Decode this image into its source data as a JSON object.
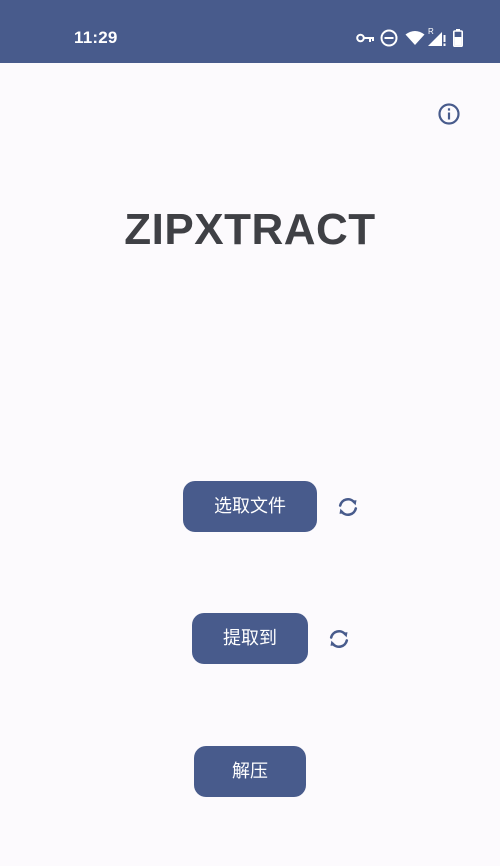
{
  "status_bar": {
    "time": "11:29",
    "icons": [
      "vpn-key-icon",
      "do-not-disturb-icon",
      "wifi-icon",
      "cell-signal-roaming-icon",
      "battery-icon"
    ]
  },
  "app": {
    "title": "ZIPXTRACT",
    "info_icon": "info-icon"
  },
  "actions": {
    "select_file_label": "选取文件",
    "extract_to_label": "提取到",
    "unzip_label": "解压",
    "refresh_icon": "refresh-icon"
  },
  "colors": {
    "primary": "#485b8c",
    "background": "#fcfafd",
    "title": "#3f4045"
  }
}
